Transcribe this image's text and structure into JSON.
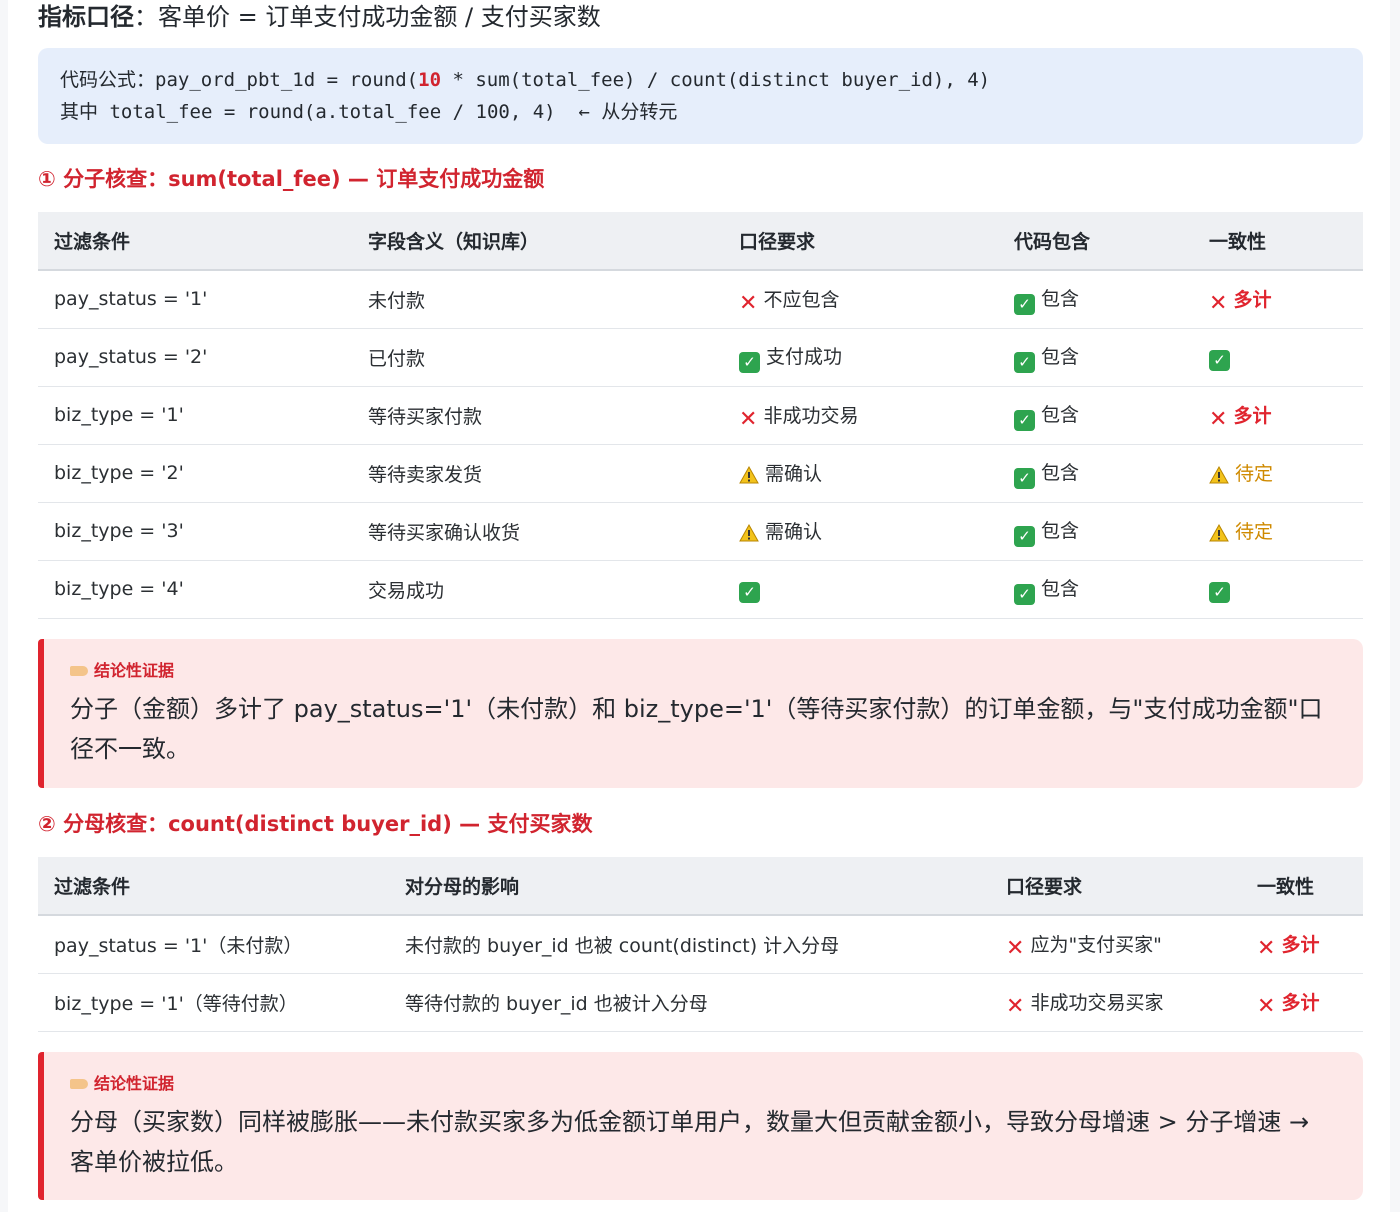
{
  "metric": {
    "label": "指标口径",
    "colon": "：",
    "definition": "客单价 = 订单支付成功金额 / 支付买家数"
  },
  "code": {
    "line1_prefix": "代码公式：",
    "line1_a": "pay_ord_pbt_1d = round(",
    "line1_hl": "10",
    "line1_b": " * sum(total_fee) / count(distinct buyer_id), 4)",
    "line2_prefix": "其中",
    "line2_code": " total_fee = round(a.total_fee / 100, 4)  ← ",
    "line2_suffix": "从分转元"
  },
  "section1": {
    "title": "① 分子核查：sum(total_fee) — 订单支付成功金额",
    "headers": [
      "过滤条件",
      "字段含义（知识库）",
      "口径要求",
      "代码包含",
      "一致性"
    ],
    "rows": [
      {
        "filter": "pay_status = '1'",
        "meaning": "未付款",
        "req_mark": "cross",
        "req": "不应包含",
        "inc_mark": "check",
        "inc": "包含",
        "con_mark": "cross",
        "con": "多计",
        "con_style": "red"
      },
      {
        "filter": "pay_status = '2'",
        "meaning": "已付款",
        "req_mark": "check",
        "req": "支付成功",
        "inc_mark": "check",
        "inc": "包含",
        "con_mark": "check",
        "con": "",
        "con_style": ""
      },
      {
        "filter": "biz_type = '1'",
        "meaning": "等待买家付款",
        "req_mark": "cross",
        "req": "非成功交易",
        "inc_mark": "check",
        "inc": "包含",
        "con_mark": "cross",
        "con": "多计",
        "con_style": "red"
      },
      {
        "filter": "biz_type = '2'",
        "meaning": "等待卖家发货",
        "req_mark": "warn",
        "req": "需确认",
        "inc_mark": "check",
        "inc": "包含",
        "con_mark": "warn",
        "con": "待定",
        "con_style": "amber"
      },
      {
        "filter": "biz_type = '3'",
        "meaning": "等待买家确认收货",
        "req_mark": "warn",
        "req": "需确认",
        "inc_mark": "check",
        "inc": "包含",
        "con_mark": "warn",
        "con": "待定",
        "con_style": "amber"
      },
      {
        "filter": "biz_type = '4'",
        "meaning": "交易成功",
        "req_mark": "check",
        "req": "",
        "inc_mark": "check",
        "inc": "包含",
        "con_mark": "check",
        "con": "",
        "con_style": ""
      }
    ]
  },
  "callout1": {
    "tag": "结论性证据",
    "text": "分子（金额）多计了 pay_status='1'（未付款）和 biz_type='1'（等待买家付款）的订单金额，与\"支付成功金额\"口径不一致。"
  },
  "section2": {
    "title": "② 分母核查：count(distinct buyer_id) — 支付买家数",
    "headers": [
      "过滤条件",
      "对分母的影响",
      "口径要求",
      "一致性"
    ],
    "rows": [
      {
        "filter": "pay_status = '1'（未付款）",
        "impact": "未付款的 buyer_id 也被 count(distinct) 计入分母",
        "req_mark": "cross",
        "req": "应为\"支付买家\"",
        "con_mark": "cross",
        "con": "多计"
      },
      {
        "filter": "biz_type = '1'（等待付款）",
        "impact": "等待付款的 buyer_id 也被计入分母",
        "req_mark": "cross",
        "req": "非成功交易买家",
        "con_mark": "cross",
        "con": "多计"
      }
    ]
  },
  "callout2": {
    "tag": "结论性证据",
    "text": "分母（买家数）同样被膨胀——未付款买家多为低金额订单用户，数量大但贡献金额小，导致分母增速 > 分子增速 → 客单价被拉低。"
  }
}
